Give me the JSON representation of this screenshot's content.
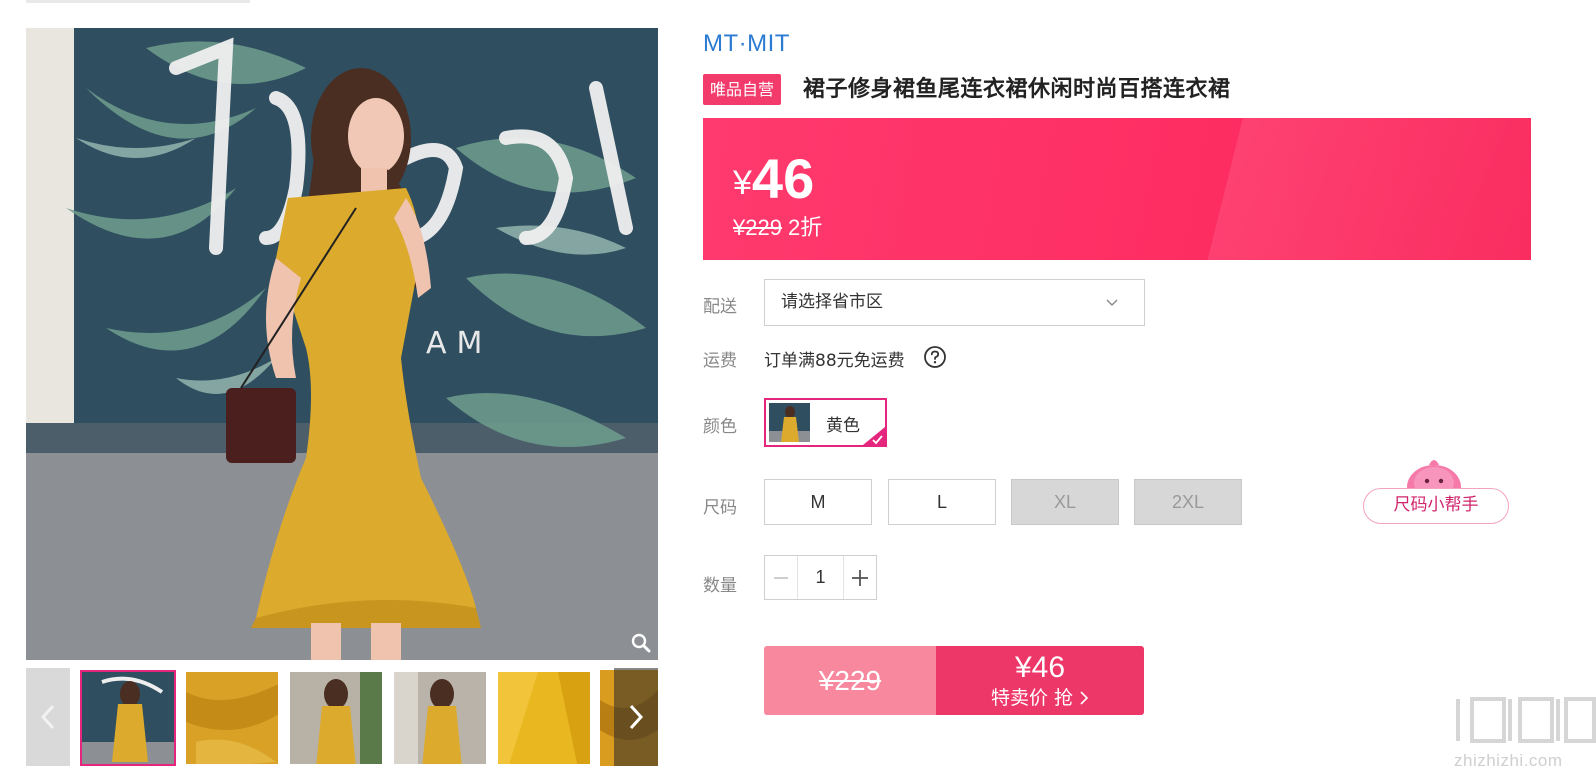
{
  "gallery": {
    "main_image_alt": "product-photo-yellow-dress",
    "thumbnails": [
      "thumb-1",
      "thumb-2",
      "thumb-3",
      "thumb-4",
      "thumb-5",
      "thumb-6"
    ],
    "active_thumbnail": 0
  },
  "product": {
    "brand": "MT·MIT",
    "self_operated_tag": "唯品自营",
    "title": "裙子修身裙鱼尾连衣裙休闲时尚百搭连衣裙"
  },
  "price": {
    "currency_symbol": "¥",
    "current": "46",
    "original": "¥229",
    "discount": "2折"
  },
  "delivery": {
    "label": "配送",
    "placeholder": "请选择省市区"
  },
  "shipping": {
    "label": "运费",
    "text": "订单满88元免运费"
  },
  "color": {
    "label": "颜色",
    "options": [
      {
        "name": "黄色",
        "selected": true
      }
    ]
  },
  "size": {
    "label": "尺码",
    "options": [
      {
        "name": "M",
        "available": true
      },
      {
        "name": "L",
        "available": true
      },
      {
        "name": "XL",
        "available": false
      },
      {
        "name": "2XL",
        "available": false
      }
    ],
    "helper": "尺码小帮手"
  },
  "quantity": {
    "label": "数量",
    "value": "1"
  },
  "buy": {
    "original": "¥229",
    "price": "¥46",
    "label": "特卖价 抢"
  },
  "watermark": {
    "text": "zhizhizhi.com"
  },
  "colors": {
    "accent": "#fe2f64",
    "brand": "#2c7bd3",
    "selected_border": "#e4267c"
  }
}
